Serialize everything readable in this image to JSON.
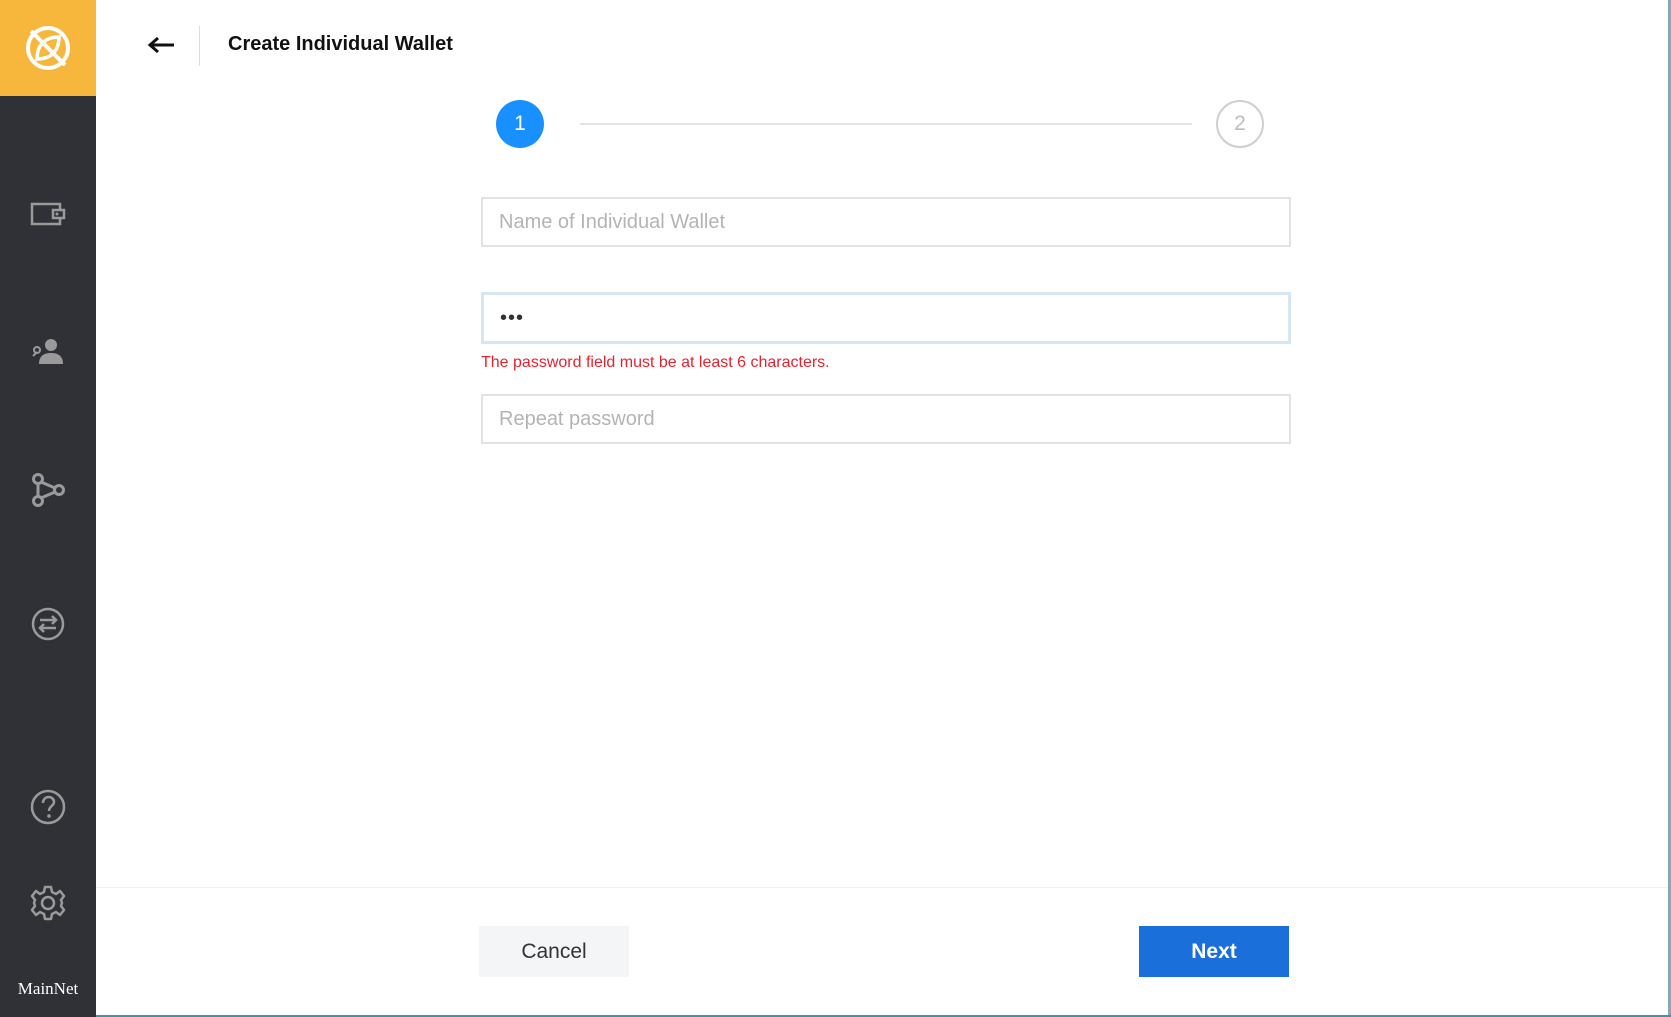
{
  "sidebar": {
    "logo_icon": "leaf-slash-logo",
    "brand_color": "#f6b73c",
    "background": "#2f3136",
    "items": [
      {
        "icon": "wallet-icon"
      },
      {
        "icon": "contacts-icon"
      },
      {
        "icon": "network-nodes-icon"
      },
      {
        "icon": "exchange-icon"
      }
    ],
    "bottom_items": [
      {
        "icon": "help-icon"
      },
      {
        "icon": "settings-icon"
      }
    ],
    "network_label": "MainNet"
  },
  "header": {
    "back_icon": "arrow-left-icon",
    "title": "Create Individual Wallet"
  },
  "stepper": {
    "current_step": "1",
    "next_step": "2",
    "active_color": "#1890ff"
  },
  "form": {
    "wallet_name": {
      "placeholder": "Name of Individual Wallet",
      "value": ""
    },
    "password": {
      "value": "•••"
    },
    "password_error": "The password field must be at least 6 characters.",
    "repeat_password": {
      "placeholder": "Repeat password",
      "value": ""
    },
    "error_color": "#e8222d"
  },
  "footer": {
    "cancel_label": "Cancel",
    "next_label": "Next",
    "primary_color": "#1a6fdb"
  }
}
